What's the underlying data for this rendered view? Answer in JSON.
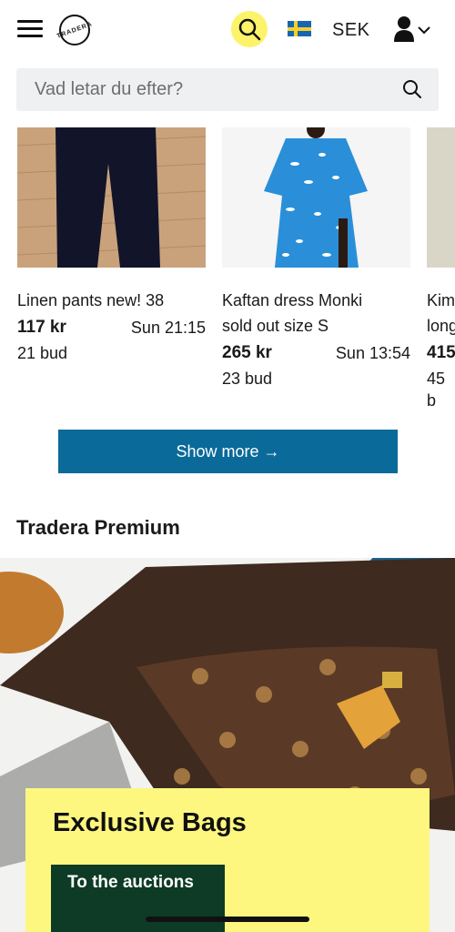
{
  "header": {
    "logo_text": "TRADERA",
    "currency": "SEK"
  },
  "search": {
    "placeholder": "Vad letar du efter?"
  },
  "listings": [
    {
      "title": "Linen pants new! 38",
      "price": "117 kr",
      "time": "Sun 21:15",
      "bids": "21 bud"
    },
    {
      "title": "Kaftan dress Monki",
      "title_line2": "sold out size S",
      "price": "265 kr",
      "time": "Sun 13:54",
      "bids": "23 bud"
    },
    {
      "title": "Kim",
      "title_line2": "long",
      "price": "415",
      "bids": "45 b"
    }
  ],
  "show_more_label": "Show more →",
  "premium": {
    "section_title": "Tradera Premium",
    "promo_title": "Exclusive Bags",
    "promo_button": "To the auctions"
  },
  "colors": {
    "accent_yellow": "#fdf36a",
    "show_more_blue": "#0a6a99",
    "promo_yellow": "#fdf780",
    "promo_button_green": "#0d3b26"
  }
}
